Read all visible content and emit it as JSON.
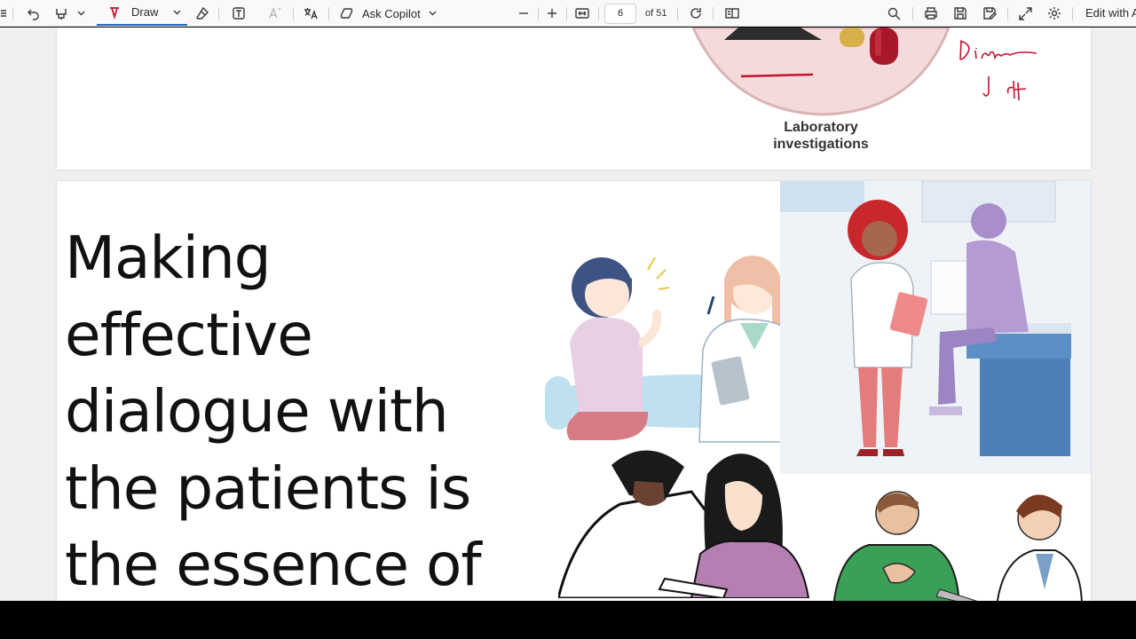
{
  "toolbar": {
    "draw_label": "Draw",
    "copilot_label": "Ask Copilot",
    "page_current": "6",
    "page_total": "of 51",
    "edit_label": "Edit with A"
  },
  "page_prev": {
    "caption_line1": "Laboratory",
    "caption_line2": "investigations"
  },
  "slide": {
    "title_lines": [
      "Making",
      "effective",
      "dialogue with",
      "the patients is",
      "the essence of"
    ]
  },
  "colors": {
    "accent": "#2a6bc2",
    "ink_annotation": "#c4122f",
    "toolbar_bg": "#f9f9f9"
  }
}
